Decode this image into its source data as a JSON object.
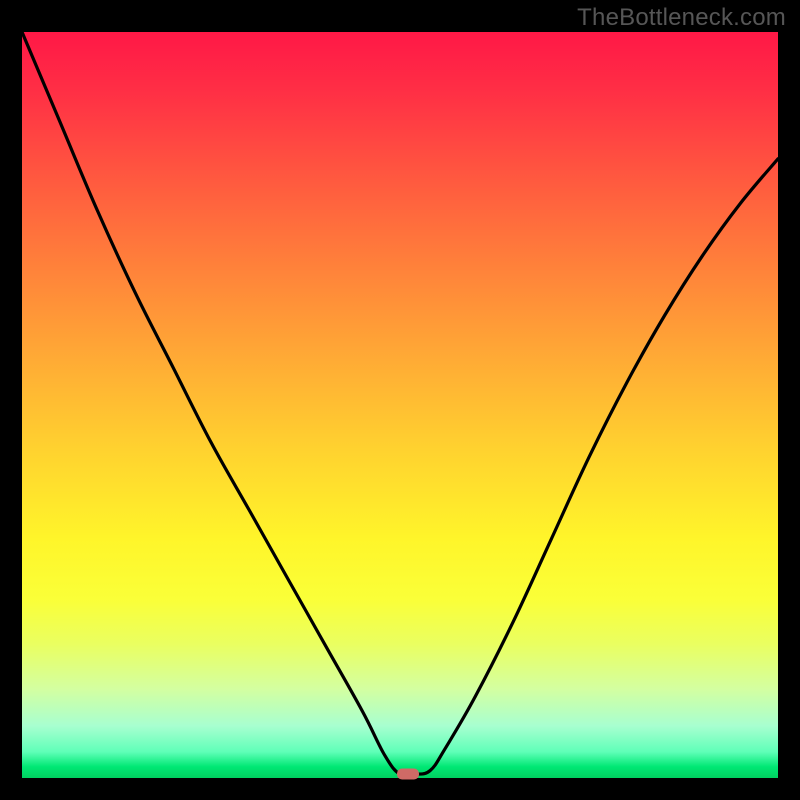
{
  "watermark": "TheBottleneck.com",
  "chart_data": {
    "type": "line",
    "title": "",
    "xlabel": "",
    "ylabel": "",
    "xlim": [
      0,
      100
    ],
    "ylim": [
      0,
      100
    ],
    "grid": false,
    "legend": false,
    "series": [
      {
        "name": "bottleneck-curve",
        "x": [
          0,
          5,
          10,
          15,
          20,
          25,
          30,
          35,
          40,
          45,
          48,
          50,
          52,
          54,
          56,
          60,
          65,
          70,
          75,
          80,
          85,
          90,
          95,
          100
        ],
        "y": [
          100,
          88,
          76,
          65,
          55,
          45,
          36,
          27,
          18,
          9,
          3,
          0.5,
          0.5,
          1,
          4,
          11,
          21,
          32,
          43,
          53,
          62,
          70,
          77,
          83
        ]
      }
    ],
    "marker": {
      "x": 51,
      "y": 0.5
    },
    "gradient_stops": [
      {
        "pos": 0,
        "color": "#ff1846"
      },
      {
        "pos": 50,
        "color": "#ffd22f"
      },
      {
        "pos": 80,
        "color": "#faff38"
      },
      {
        "pos": 100,
        "color": "#00d060"
      }
    ]
  }
}
